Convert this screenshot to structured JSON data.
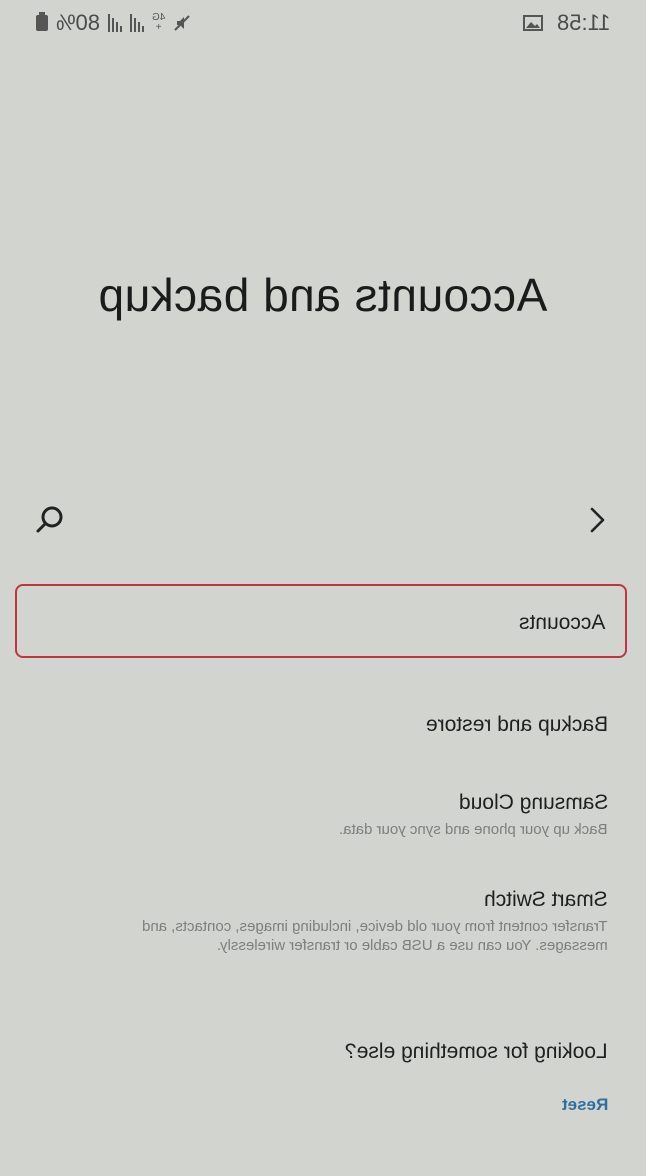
{
  "status_bar": {
    "battery_text": "80%",
    "network_badge_top": "4G",
    "network_badge_bottom": "+",
    "time": "11:58"
  },
  "page": {
    "title": "Accounts and backup"
  },
  "toolbar": {
    "search_icon": "search-icon",
    "forward_icon": "chevron-right-icon"
  },
  "list": {
    "accounts": {
      "title": "Accounts"
    },
    "backup_restore": {
      "title": "Backup and restore"
    },
    "samsung_cloud": {
      "title": "Samsung Cloud",
      "description": "Back up your phone and sync your data."
    },
    "smart_switch": {
      "title": "Smart Switch",
      "description_line1": "Transfer content from your old device, including images, contacts, and",
      "description_line2": "messages. You can use a USB cable or transfer wirelessly."
    }
  },
  "footer": {
    "looking_title": "Looking for something else?",
    "reset_label": "Reset"
  },
  "colors": {
    "background": "#d2d4d0",
    "highlight_border": "#c0353f",
    "link": "#2f6fa0"
  }
}
